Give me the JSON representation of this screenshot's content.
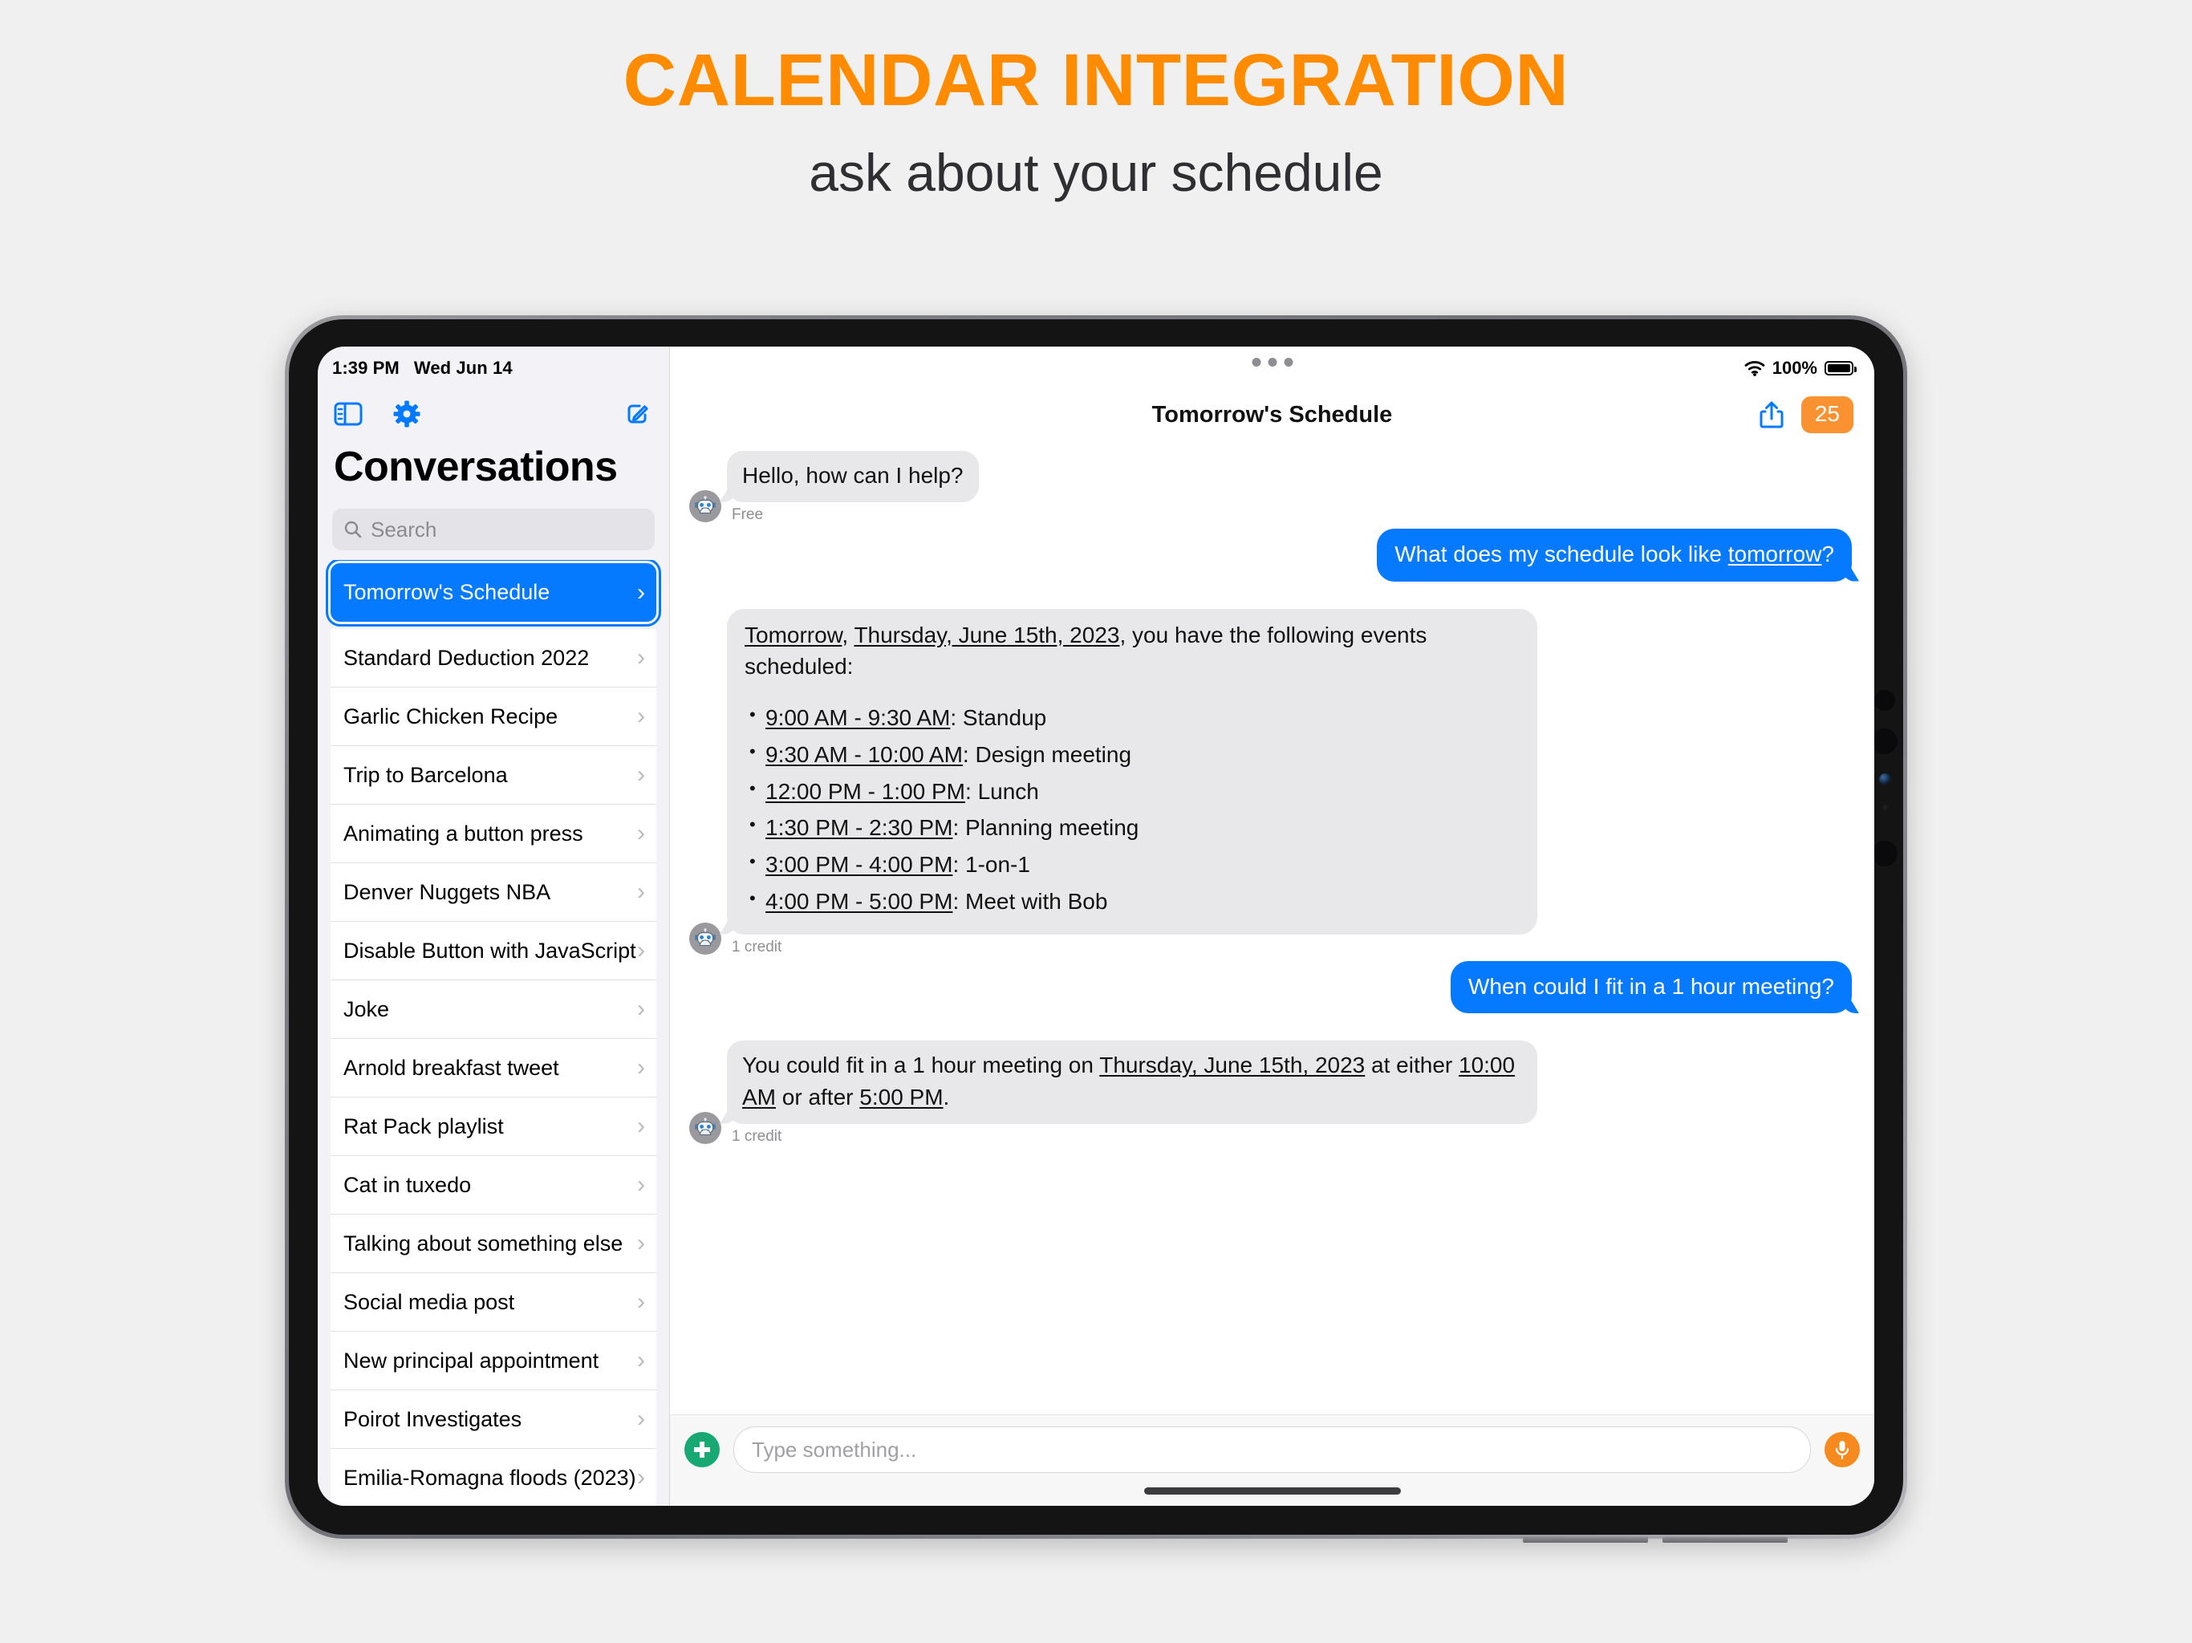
{
  "promo": {
    "title": "CALENDAR INTEGRATION",
    "subtitle": "ask about your schedule",
    "title_color": "#FF8C00"
  },
  "status_bar": {
    "time": "1:39 PM",
    "date": "Wed Jun 14",
    "battery_percent": "100%",
    "wifi_icon": "wifi-icon",
    "battery_icon": "battery-full-icon"
  },
  "sidebar": {
    "toolbar": {
      "sidebar_toggle_icon": "sidebar-toggle-icon",
      "settings_icon": "gear-icon",
      "compose_icon": "compose-icon"
    },
    "title": "Conversations",
    "search": {
      "placeholder": "Search",
      "icon": "search-icon"
    },
    "items": [
      {
        "label": "Tomorrow's Schedule",
        "selected": true
      },
      {
        "label": "Standard Deduction 2022",
        "selected": false
      },
      {
        "label": "Garlic Chicken Recipe",
        "selected": false
      },
      {
        "label": "Trip to Barcelona",
        "selected": false
      },
      {
        "label": "Animating a button press",
        "selected": false
      },
      {
        "label": "Denver Nuggets NBA",
        "selected": false
      },
      {
        "label": "Disable Button with JavaScript",
        "selected": false
      },
      {
        "label": "Joke",
        "selected": false
      },
      {
        "label": "Arnold breakfast tweet",
        "selected": false
      },
      {
        "label": "Rat Pack playlist",
        "selected": false
      },
      {
        "label": "Cat in tuxedo",
        "selected": false
      },
      {
        "label": "Talking about something else",
        "selected": false
      },
      {
        "label": "Social media post",
        "selected": false
      },
      {
        "label": "New principal appointment",
        "selected": false
      },
      {
        "label": "Poirot Investigates",
        "selected": false
      },
      {
        "label": "Emilia-Romagna floods (2023)",
        "selected": false
      }
    ],
    "chevron": "›"
  },
  "chat": {
    "title": "Tomorrow's Schedule",
    "multitask_icon": "multitask-dots-icon",
    "share_icon": "share-icon",
    "credits_badge": "25",
    "accent_blue": "#057AFF",
    "accent_orange": "#FB9231",
    "messages": [
      {
        "role": "assistant",
        "avatar": "robot-avatar-icon",
        "text": "Hello, how can I help?",
        "meta": "Free"
      },
      {
        "role": "user",
        "text_pre": "What does my schedule look like ",
        "text_link": "tomorrow",
        "text_post": "?"
      },
      {
        "role": "assistant",
        "avatar": "robot-avatar-icon",
        "intro_a": "Tomorrow",
        "intro_b": "Thursday, June 15th, 2023",
        "intro_tail": ", you have the following events scheduled:",
        "events": [
          {
            "time": "9:00 AM - 9:30 AM",
            "name": ": Standup"
          },
          {
            "time": "9:30 AM - 10:00 AM",
            "name": ": Design meeting"
          },
          {
            "time": "12:00 PM - 1:00 PM",
            "name": ": Lunch"
          },
          {
            "time": "1:30 PM - 2:30 PM",
            "name": ": Planning meeting"
          },
          {
            "time": "3:00 PM - 4:00 PM",
            "name": ": 1-on-1"
          },
          {
            "time": "4:00 PM - 5:00 PM",
            "name": ": Meet with Bob"
          }
        ],
        "meta": "1 credit"
      },
      {
        "role": "user",
        "text": "When could I fit in a 1 hour meeting?"
      },
      {
        "role": "assistant",
        "avatar": "robot-avatar-icon",
        "seg1": "You could fit in a 1 hour meeting on ",
        "seg2": "Thursday, June 15th, 2023",
        "seg3": " at either ",
        "seg4": "10:00 AM",
        "seg5": " or after ",
        "seg6": "5:00 PM",
        "seg7": ".",
        "meta": "1 credit"
      }
    ]
  },
  "composer": {
    "add_icon": "plus-circle-icon",
    "placeholder": "Type something...",
    "mic_icon": "microphone-icon"
  }
}
